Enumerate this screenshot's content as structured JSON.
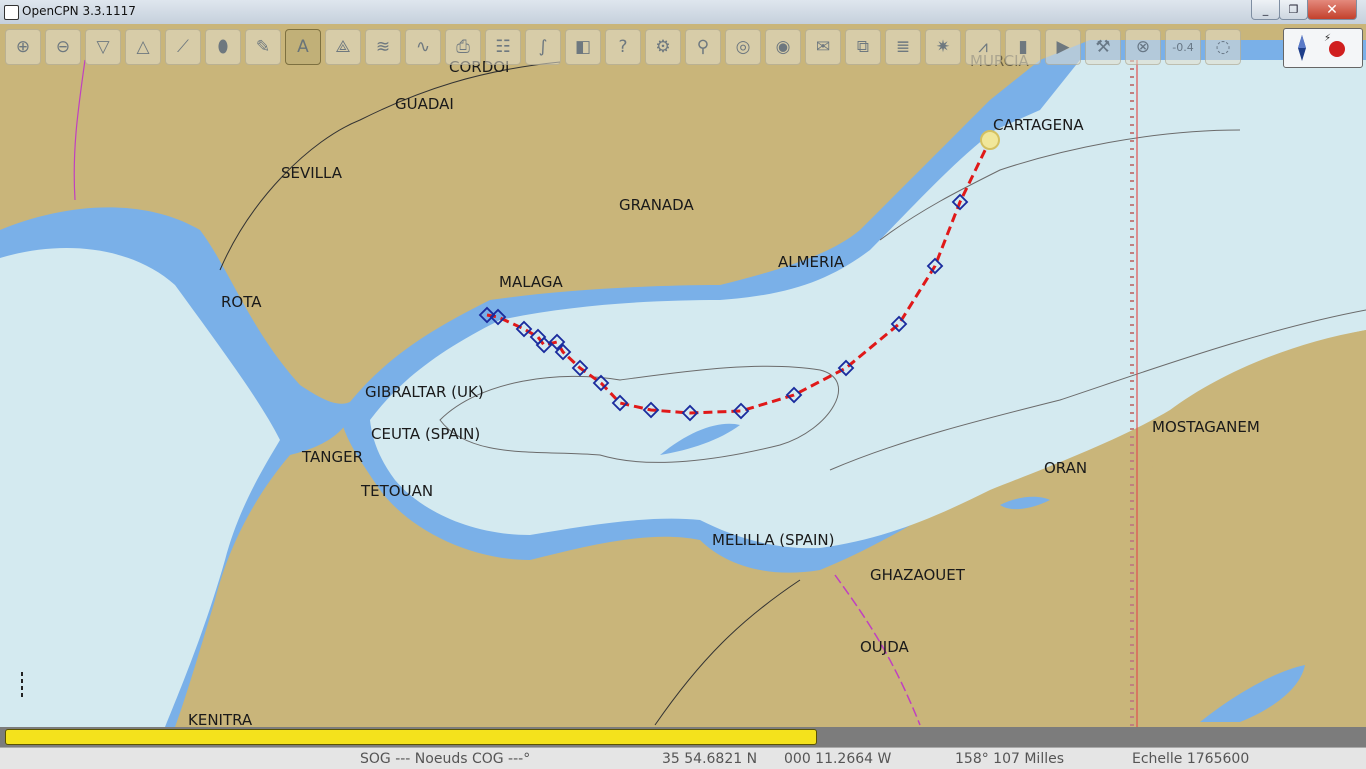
{
  "window": {
    "title": "OpenCPN 3.3.1117",
    "min": "_",
    "max": "❐",
    "close": "✕"
  },
  "toolbar": {
    "tools": [
      {
        "name": "zoom-in-icon",
        "glyph": "⊕"
      },
      {
        "name": "zoom-out-icon",
        "glyph": "⊖"
      },
      {
        "name": "scale-in-icon",
        "glyph": "▽"
      },
      {
        "name": "scale-out-icon",
        "glyph": "△"
      },
      {
        "name": "route-icon",
        "glyph": "⟋"
      },
      {
        "name": "ship-icon",
        "glyph": "⬮"
      },
      {
        "name": "settings-icon",
        "glyph": "✎"
      },
      {
        "name": "text-icon",
        "glyph": "A"
      },
      {
        "name": "mark-icon",
        "glyph": "⟁"
      },
      {
        "name": "current-icon",
        "glyph": "≋"
      },
      {
        "name": "tide-icon",
        "glyph": "∿"
      },
      {
        "name": "print-icon",
        "glyph": "⎙"
      },
      {
        "name": "route-manager-icon",
        "glyph": "☷"
      },
      {
        "name": "track-icon",
        "glyph": "∫"
      },
      {
        "name": "color-scheme-icon",
        "glyph": "◧"
      },
      {
        "name": "help-icon",
        "glyph": "?"
      },
      {
        "name": "plugin-icon",
        "glyph": "⚙"
      },
      {
        "name": "search-icon",
        "glyph": "⚲"
      },
      {
        "name": "dashboard-icon",
        "glyph": "◎"
      },
      {
        "name": "globe-icon",
        "glyph": "◉"
      },
      {
        "name": "log-icon",
        "glyph": "✉"
      },
      {
        "name": "windows-icon",
        "glyph": "⧉"
      },
      {
        "name": "list-icon",
        "glyph": "≣"
      },
      {
        "name": "radar-icon",
        "glyph": "✷"
      },
      {
        "name": "signal-icon",
        "glyph": "⩘"
      },
      {
        "name": "layer-icon",
        "glyph": "▮"
      },
      {
        "name": "play-icon",
        "glyph": "▶"
      },
      {
        "name": "wrench-icon",
        "glyph": "⚒"
      },
      {
        "name": "grib-icon",
        "glyph": "⊗"
      },
      {
        "name": "offset-icon",
        "glyph": "-0.4"
      },
      {
        "name": "lifebuoy-icon",
        "glyph": "◌"
      }
    ]
  },
  "map": {
    "colors": {
      "land": "#c9b57a",
      "shallow": "#7ab0e8",
      "sea": "#d4eaf0",
      "route": "#e01919",
      "waypoint": "#1a2c9e"
    },
    "labels": [
      "CORDOI",
      "GUADAI",
      "SEVILLA",
      "GRANADA",
      "MURCIA",
      "CARTAGENA",
      "ALMERIA",
      "MALAGA",
      "ROTA",
      "GIBRALTAR (UK)",
      "CEUTA (SPAIN)",
      "TANGER",
      "TETOUAN",
      "MOSTAGANEM",
      "ORAN",
      "MELILLA (SPAIN)",
      "GHAZAOUET",
      "OUJDA",
      "KENITRA"
    ],
    "route_waypoint_count": 21
  },
  "status": {
    "sog_cog": "SOG --- Noeuds COG ---°",
    "latitude": "35 54.6821 N",
    "longitude": "000 11.2664 W",
    "bearing_distance": "158°  107 Milles",
    "scale": "Echelle 1765600"
  }
}
